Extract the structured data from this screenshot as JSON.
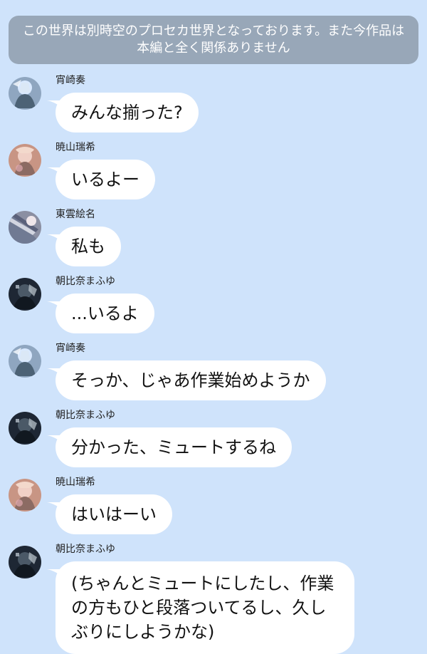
{
  "notice": {
    "text": "この世界は別時空のプロセカ世界となっております。また今作品は本編と全く関係ありません"
  },
  "messages": [
    {
      "sender": "宵崎奏",
      "text": "みんな揃った?",
      "avatar": "avatar-kanade"
    },
    {
      "sender": "暁山瑞希",
      "text": "いるよー",
      "avatar": "avatar-mizuki"
    },
    {
      "sender": "東雲絵名",
      "text": "私も",
      "avatar": "avatar-ena"
    },
    {
      "sender": "朝比奈まふゆ",
      "text": "...いるよ",
      "avatar": "avatar-mafuyu"
    },
    {
      "sender": "宵崎奏",
      "text": "そっか、じゃあ作業始めようか",
      "avatar": "avatar-kanade"
    },
    {
      "sender": "朝比奈まふゆ",
      "text": "分かった、ミュートするね",
      "avatar": "avatar-mafuyu"
    },
    {
      "sender": "暁山瑞希",
      "text": "はいはーい",
      "avatar": "avatar-mizuki"
    },
    {
      "sender": "朝比奈まふゆ",
      "text": "(ちゃんとミュートにしたし、作業の方もひと段落ついてるし、久しぶりにしようかな)",
      "avatar": "avatar-mafuyu"
    }
  ],
  "colors": {
    "background": "#cfe3fb",
    "notice_background": "#98a7b8",
    "bubble_background": "#ffffff"
  }
}
